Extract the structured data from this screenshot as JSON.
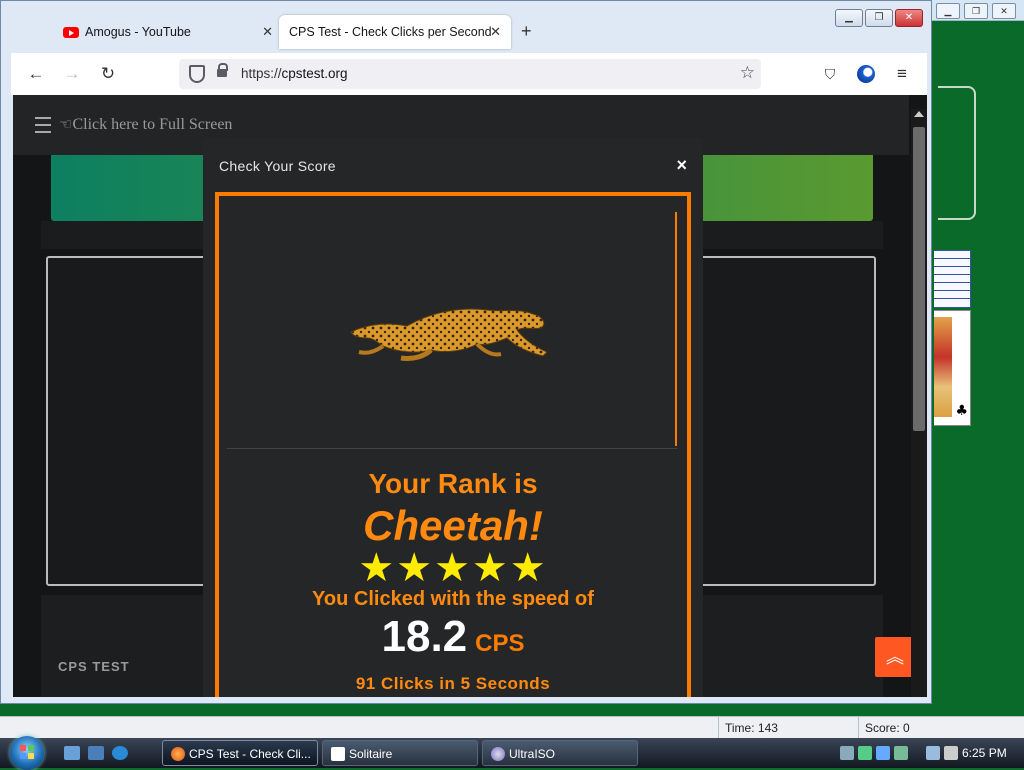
{
  "browser": {
    "tabs": [
      {
        "label": "Amogus - YouTube",
        "active": false
      },
      {
        "label": "CPS Test - Check Clicks per Second",
        "active": true
      }
    ],
    "url_prefix": "https://",
    "url_host": "cpstest.org"
  },
  "page": {
    "fullscreen_link": "Click here to Full Screen",
    "footer_label": "CPS TEST",
    "scroll_top_icon": "chevron-double-up-icon"
  },
  "modal": {
    "title": "Check Your Score",
    "close_glyph": "×",
    "rank_prefix": "Your Rank is",
    "rank_name": "Cheetah!",
    "stars": 5,
    "speed_line": "You Clicked with the speed of",
    "cps_value": "18.2",
    "cps_unit": "CPS",
    "clicks_line": "91 Clicks in 5 Seconds"
  },
  "solitaire": {
    "time_label": "Time: 143",
    "score_label": "Score: 0"
  },
  "taskbar": {
    "items": [
      {
        "label": "CPS Test - Check Cli...",
        "active": true
      },
      {
        "label": "Solitaire",
        "active": false
      },
      {
        "label": "UltraISO",
        "active": false
      }
    ],
    "clock": "6:25 PM"
  },
  "colors": {
    "accent_orange": "#ff7b00",
    "star_yellow": "#ffec00",
    "scroll_button": "#ff5722"
  }
}
